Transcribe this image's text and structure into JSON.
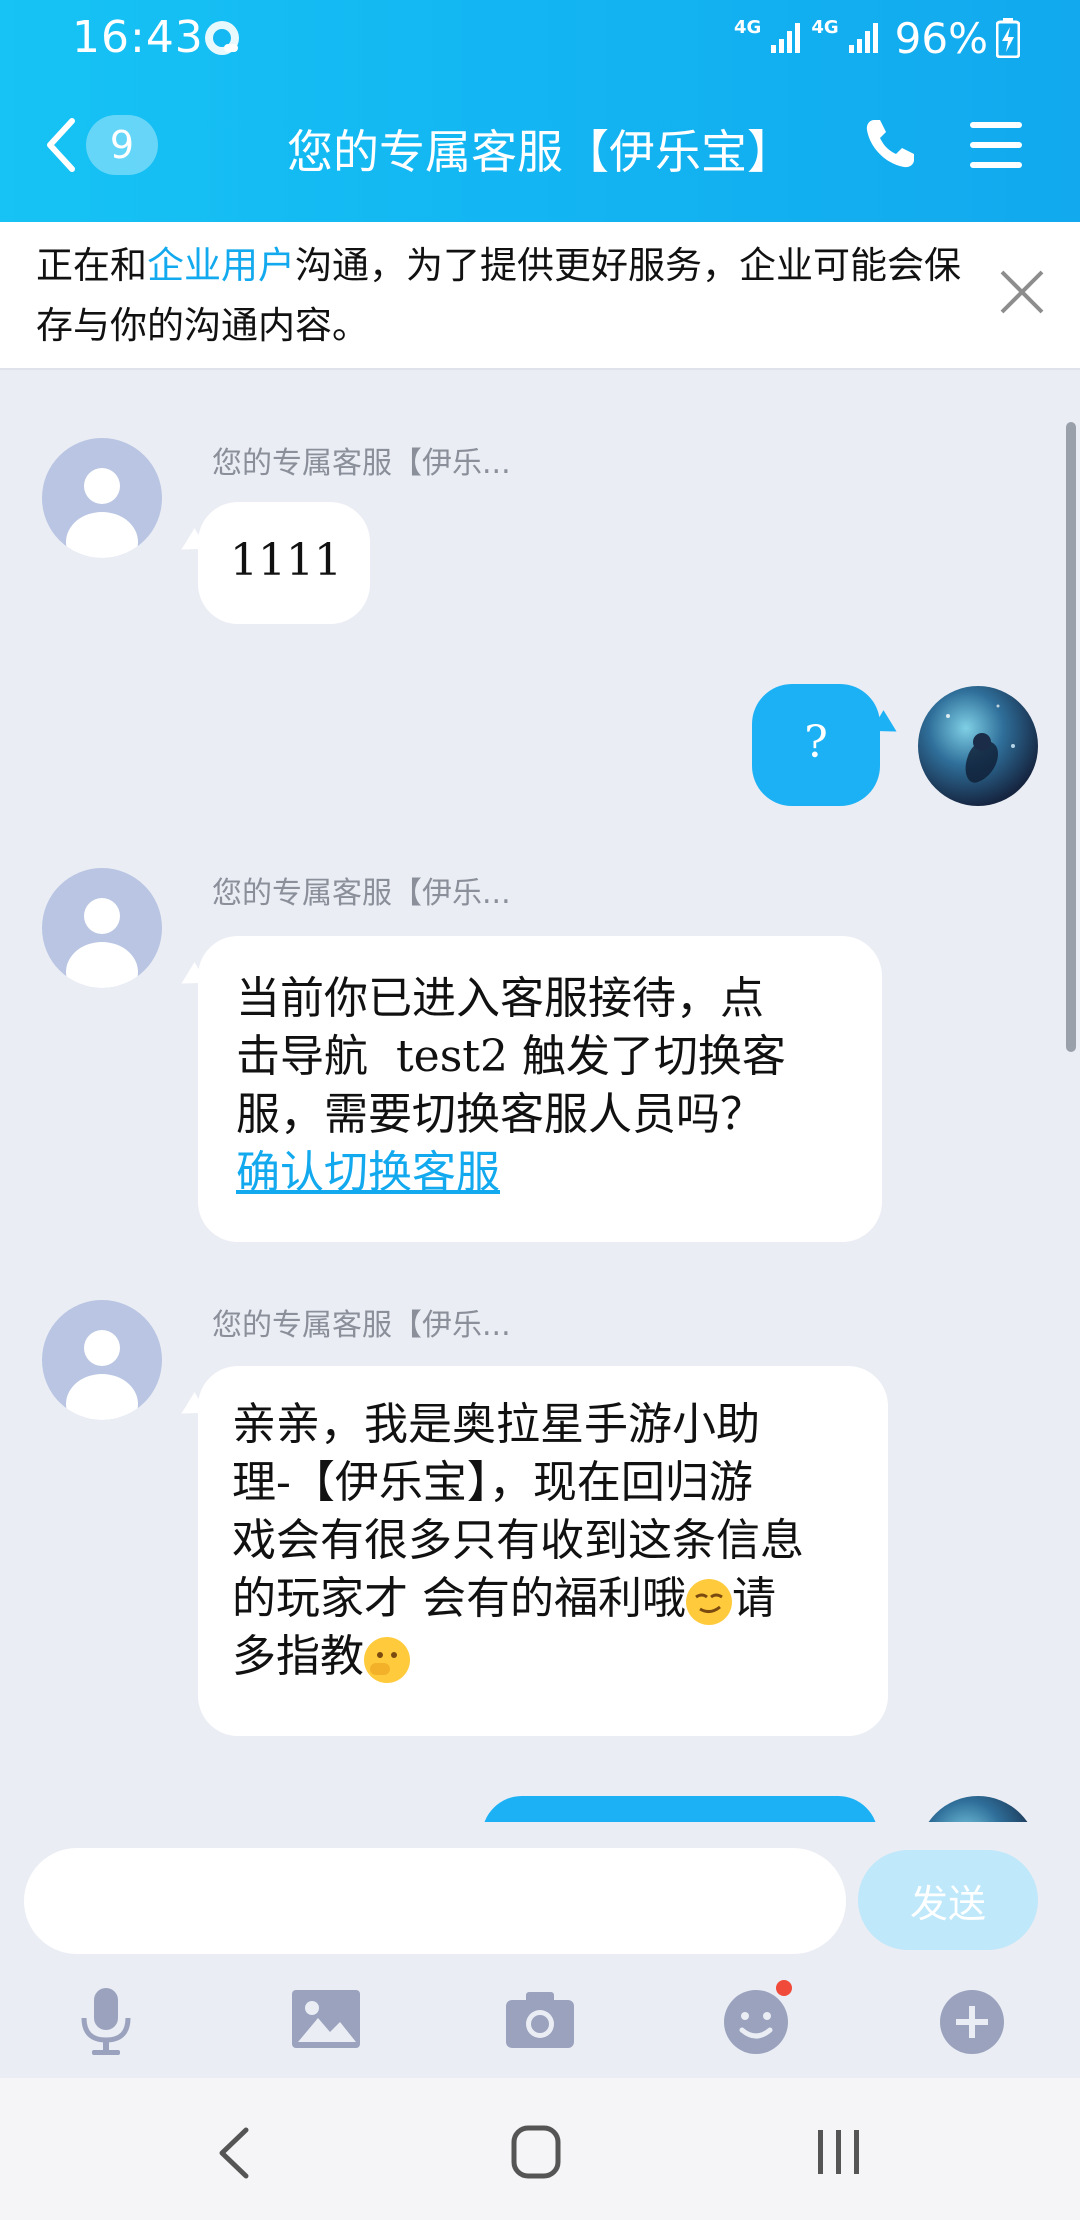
{
  "status": {
    "time": "16:43",
    "network1": "4G",
    "network2": "4G",
    "battery": "96%"
  },
  "header": {
    "unread_count": "9",
    "title": "您的专属客服【伊乐宝】"
  },
  "notice": {
    "prefix": "正在和",
    "link": "企业用户",
    "suffix": "沟通，为了提供更好服务，企业可能会保存与你的沟通内容。"
  },
  "messages": {
    "m1": {
      "sender": "您的专属客服【伊乐...",
      "text": "1111"
    },
    "m2": {
      "text": "?"
    },
    "m3": {
      "sender": "您的专属客服【伊乐...",
      "line1": "当前你已进入客服接待，点",
      "line2": "击导航  test2 触发了切换客",
      "line3": "服，需要切换客服人员吗？",
      "link": "确认切换客服"
    },
    "m4": {
      "sender": "您的专属客服【伊乐...",
      "line1": "亲亲，我是奥拉星手游小助",
      "line2": "理-【伊乐宝】，现在回归游",
      "line3": "戏会有很多只有收到这条信息",
      "line4a": "的玩家才 会有的福利哦",
      "line4b": "请",
      "line5": "多指教"
    }
  },
  "input": {
    "placeholder": "",
    "send_label": "发送"
  },
  "icons": {
    "toolbar": [
      "microphone-icon",
      "image-icon",
      "camera-icon",
      "emoji-icon",
      "plus-icon"
    ],
    "accent": "#12a9ee",
    "emoji_badge": "#f04a3a"
  }
}
